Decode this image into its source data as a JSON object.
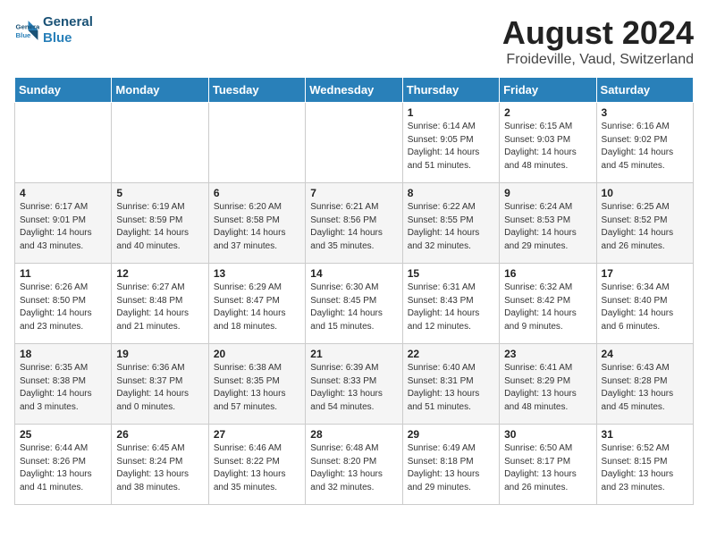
{
  "header": {
    "logo_line1": "General",
    "logo_line2": "Blue",
    "main_title": "August 2024",
    "subtitle": "Froideville, Vaud, Switzerland"
  },
  "columns": [
    "Sunday",
    "Monday",
    "Tuesday",
    "Wednesday",
    "Thursday",
    "Friday",
    "Saturday"
  ],
  "weeks": [
    [
      {
        "day": "",
        "info": ""
      },
      {
        "day": "",
        "info": ""
      },
      {
        "day": "",
        "info": ""
      },
      {
        "day": "",
        "info": ""
      },
      {
        "day": "1",
        "info": "Sunrise: 6:14 AM\nSunset: 9:05 PM\nDaylight: 14 hours\nand 51 minutes."
      },
      {
        "day": "2",
        "info": "Sunrise: 6:15 AM\nSunset: 9:03 PM\nDaylight: 14 hours\nand 48 minutes."
      },
      {
        "day": "3",
        "info": "Sunrise: 6:16 AM\nSunset: 9:02 PM\nDaylight: 14 hours\nand 45 minutes."
      }
    ],
    [
      {
        "day": "4",
        "info": "Sunrise: 6:17 AM\nSunset: 9:01 PM\nDaylight: 14 hours\nand 43 minutes."
      },
      {
        "day": "5",
        "info": "Sunrise: 6:19 AM\nSunset: 8:59 PM\nDaylight: 14 hours\nand 40 minutes."
      },
      {
        "day": "6",
        "info": "Sunrise: 6:20 AM\nSunset: 8:58 PM\nDaylight: 14 hours\nand 37 minutes."
      },
      {
        "day": "7",
        "info": "Sunrise: 6:21 AM\nSunset: 8:56 PM\nDaylight: 14 hours\nand 35 minutes."
      },
      {
        "day": "8",
        "info": "Sunrise: 6:22 AM\nSunset: 8:55 PM\nDaylight: 14 hours\nand 32 minutes."
      },
      {
        "day": "9",
        "info": "Sunrise: 6:24 AM\nSunset: 8:53 PM\nDaylight: 14 hours\nand 29 minutes."
      },
      {
        "day": "10",
        "info": "Sunrise: 6:25 AM\nSunset: 8:52 PM\nDaylight: 14 hours\nand 26 minutes."
      }
    ],
    [
      {
        "day": "11",
        "info": "Sunrise: 6:26 AM\nSunset: 8:50 PM\nDaylight: 14 hours\nand 23 minutes."
      },
      {
        "day": "12",
        "info": "Sunrise: 6:27 AM\nSunset: 8:48 PM\nDaylight: 14 hours\nand 21 minutes."
      },
      {
        "day": "13",
        "info": "Sunrise: 6:29 AM\nSunset: 8:47 PM\nDaylight: 14 hours\nand 18 minutes."
      },
      {
        "day": "14",
        "info": "Sunrise: 6:30 AM\nSunset: 8:45 PM\nDaylight: 14 hours\nand 15 minutes."
      },
      {
        "day": "15",
        "info": "Sunrise: 6:31 AM\nSunset: 8:43 PM\nDaylight: 14 hours\nand 12 minutes."
      },
      {
        "day": "16",
        "info": "Sunrise: 6:32 AM\nSunset: 8:42 PM\nDaylight: 14 hours\nand 9 minutes."
      },
      {
        "day": "17",
        "info": "Sunrise: 6:34 AM\nSunset: 8:40 PM\nDaylight: 14 hours\nand 6 minutes."
      }
    ],
    [
      {
        "day": "18",
        "info": "Sunrise: 6:35 AM\nSunset: 8:38 PM\nDaylight: 14 hours\nand 3 minutes."
      },
      {
        "day": "19",
        "info": "Sunrise: 6:36 AM\nSunset: 8:37 PM\nDaylight: 14 hours\nand 0 minutes."
      },
      {
        "day": "20",
        "info": "Sunrise: 6:38 AM\nSunset: 8:35 PM\nDaylight: 13 hours\nand 57 minutes."
      },
      {
        "day": "21",
        "info": "Sunrise: 6:39 AM\nSunset: 8:33 PM\nDaylight: 13 hours\nand 54 minutes."
      },
      {
        "day": "22",
        "info": "Sunrise: 6:40 AM\nSunset: 8:31 PM\nDaylight: 13 hours\nand 51 minutes."
      },
      {
        "day": "23",
        "info": "Sunrise: 6:41 AM\nSunset: 8:29 PM\nDaylight: 13 hours\nand 48 minutes."
      },
      {
        "day": "24",
        "info": "Sunrise: 6:43 AM\nSunset: 8:28 PM\nDaylight: 13 hours\nand 45 minutes."
      }
    ],
    [
      {
        "day": "25",
        "info": "Sunrise: 6:44 AM\nSunset: 8:26 PM\nDaylight: 13 hours\nand 41 minutes."
      },
      {
        "day": "26",
        "info": "Sunrise: 6:45 AM\nSunset: 8:24 PM\nDaylight: 13 hours\nand 38 minutes."
      },
      {
        "day": "27",
        "info": "Sunrise: 6:46 AM\nSunset: 8:22 PM\nDaylight: 13 hours\nand 35 minutes."
      },
      {
        "day": "28",
        "info": "Sunrise: 6:48 AM\nSunset: 8:20 PM\nDaylight: 13 hours\nand 32 minutes."
      },
      {
        "day": "29",
        "info": "Sunrise: 6:49 AM\nSunset: 8:18 PM\nDaylight: 13 hours\nand 29 minutes."
      },
      {
        "day": "30",
        "info": "Sunrise: 6:50 AM\nSunset: 8:17 PM\nDaylight: 13 hours\nand 26 minutes."
      },
      {
        "day": "31",
        "info": "Sunrise: 6:52 AM\nSunset: 8:15 PM\nDaylight: 13 hours\nand 23 minutes."
      }
    ]
  ]
}
